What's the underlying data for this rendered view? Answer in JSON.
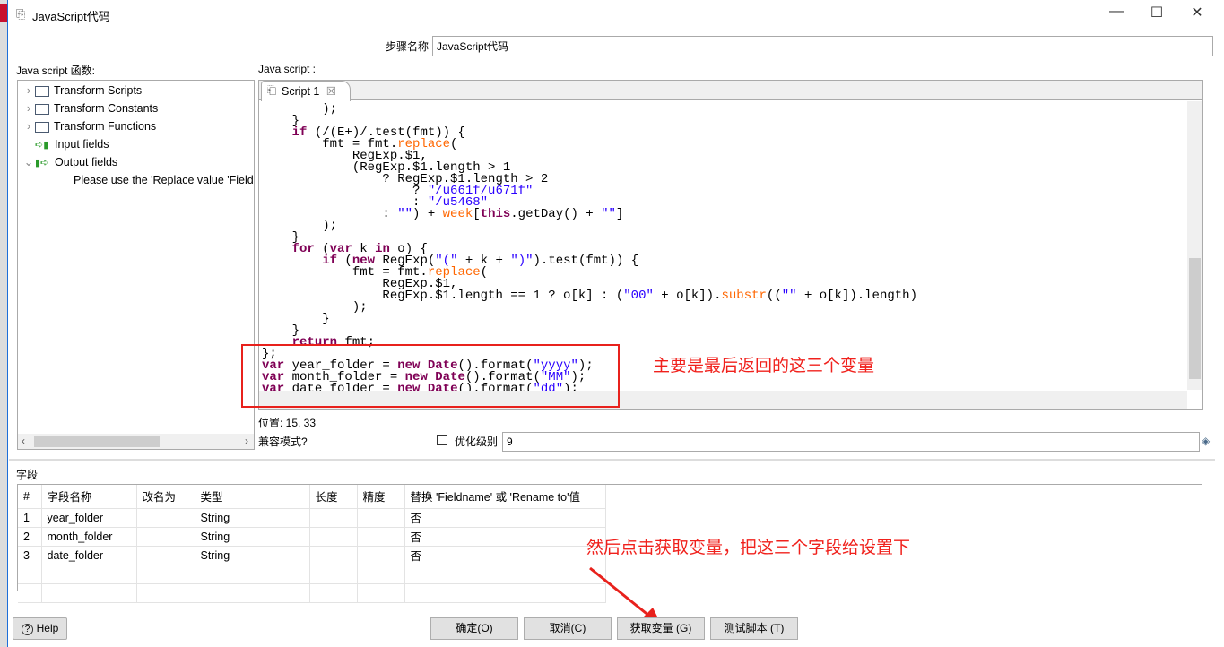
{
  "window": {
    "title": "JavaScript代码",
    "minimize": "—",
    "maximize": "☐",
    "close": "✕"
  },
  "step_name": {
    "label": "步骤名称",
    "value": "JavaScript代码"
  },
  "functions_label": "Java script 函数:",
  "script_label": "Java script :",
  "tree": [
    {
      "label": "Transform Scripts",
      "icon": "folder-icon",
      "expander": "›"
    },
    {
      "label": "Transform Constants",
      "icon": "folder-icon",
      "expander": "›"
    },
    {
      "label": "Transform Functions",
      "icon": "folder-icon",
      "expander": "›"
    },
    {
      "label": "Input fields",
      "icon": "input-fields-icon",
      "expander": ""
    },
    {
      "label": "Output fields",
      "icon": "output-fields-icon",
      "expander": "⌄"
    },
    {
      "label": "Please use the 'Replace value 'Field",
      "icon": "",
      "expander": ""
    }
  ],
  "editor": {
    "tab": "Script 1",
    "tab_close": "☒",
    "lines": [
      [
        [
          "",
          "        );"
        ]
      ],
      [
        [
          "",
          "    }"
        ]
      ],
      [
        [
          "",
          "    "
        ],
        [
          "k",
          "if"
        ],
        [
          "",
          " (/(E+)/.test(fmt)) {"
        ]
      ],
      [
        [
          "",
          "        fmt = fmt."
        ],
        [
          "o",
          "replace"
        ],
        [
          "",
          "("
        ]
      ],
      [
        [
          "",
          "            RegExp.$1,"
        ]
      ],
      [
        [
          "",
          "            (RegExp.$1.length > 1"
        ]
      ],
      [
        [
          "",
          "                ? RegExp.$1.length > 2"
        ]
      ],
      [
        [
          "",
          "                    ? "
        ],
        [
          "s",
          "\"/u661f/u671f\""
        ]
      ],
      [
        [
          "",
          "                    : "
        ],
        [
          "s",
          "\"/u5468\""
        ]
      ],
      [
        [
          "",
          "                : "
        ],
        [
          "s",
          "\"\""
        ],
        [
          "",
          ") + "
        ],
        [
          "o",
          "week"
        ],
        [
          "",
          "["
        ],
        [
          "k",
          "this"
        ],
        [
          "",
          ".getDay() + "
        ],
        [
          "s",
          "\"\""
        ],
        [
          "",
          "]"
        ]
      ],
      [
        [
          "",
          "        );"
        ]
      ],
      [
        [
          "",
          "    }"
        ]
      ],
      [
        [
          "",
          "    "
        ],
        [
          "k",
          "for"
        ],
        [
          "",
          " ("
        ],
        [
          "k",
          "var"
        ],
        [
          "",
          " k "
        ],
        [
          "k",
          "in"
        ],
        [
          "",
          " o) {"
        ]
      ],
      [
        [
          "",
          "        "
        ],
        [
          "k",
          "if"
        ],
        [
          "",
          " ("
        ],
        [
          "k",
          "new"
        ],
        [
          "",
          " RegExp("
        ],
        [
          "s",
          "\"(\""
        ],
        [
          "",
          " + k + "
        ],
        [
          "s",
          "\")\""
        ],
        [
          "",
          ").test(fmt)) {"
        ]
      ],
      [
        [
          "",
          "            fmt = fmt."
        ],
        [
          "o",
          "replace"
        ],
        [
          "",
          "("
        ]
      ],
      [
        [
          "",
          "                RegExp.$1,"
        ]
      ],
      [
        [
          "",
          "                RegExp.$1.length == 1 ? o[k] : ("
        ],
        [
          "s",
          "\"00\""
        ],
        [
          "",
          " + o[k])."
        ],
        [
          "o",
          "substr"
        ],
        [
          "",
          "(("
        ],
        [
          "s",
          "\"\""
        ],
        [
          "",
          " + o[k]).length)"
        ]
      ],
      [
        [
          "",
          "            );"
        ]
      ],
      [
        [
          "",
          "        }"
        ]
      ],
      [
        [
          "",
          "    }"
        ]
      ],
      [
        [
          "",
          "    "
        ],
        [
          "k",
          "return"
        ],
        [
          "",
          " fmt;"
        ]
      ],
      [
        [
          "",
          "};"
        ]
      ],
      [
        [
          "k",
          "var"
        ],
        [
          "",
          " year_folder = "
        ],
        [
          "k",
          "new"
        ],
        [
          "",
          " "
        ],
        [
          "k",
          "Date"
        ],
        [
          "",
          "().format("
        ],
        [
          "s",
          "\"yyyy\""
        ],
        [
          "",
          ");"
        ]
      ],
      [
        [
          "k",
          "var"
        ],
        [
          "",
          " month_folder = "
        ],
        [
          "k",
          "new"
        ],
        [
          "",
          " "
        ],
        [
          "k",
          "Date"
        ],
        [
          "",
          "().format("
        ],
        [
          "s",
          "\"MM\""
        ],
        [
          "",
          ");"
        ]
      ],
      [
        [
          "k",
          "var"
        ],
        [
          "",
          " date_folder = "
        ],
        [
          "k",
          "new"
        ],
        [
          "",
          " "
        ],
        [
          "k",
          "Date"
        ],
        [
          "",
          "().format("
        ],
        [
          "s",
          "\"dd\""
        ],
        [
          "",
          ");"
        ]
      ]
    ]
  },
  "position": "位置: 15, 33",
  "compat_label": "兼容模式?",
  "optimize": {
    "label": "优化级别",
    "value": "9",
    "checked": false
  },
  "fields_label": "字段",
  "table": {
    "headers": [
      "#",
      "字段名称",
      "改名为",
      "类型",
      "长度",
      "精度",
      "替换 'Fieldname' 或 'Rename to'值"
    ],
    "rows": [
      [
        "1",
        "year_folder",
        "",
        "String",
        "",
        "",
        "否"
      ],
      [
        "2",
        "month_folder",
        "",
        "String",
        "",
        "",
        "否"
      ],
      [
        "3",
        "date_folder",
        "",
        "String",
        "",
        "",
        "否"
      ]
    ]
  },
  "annotations": {
    "top": "主要是最后返回的这三个变量",
    "bottom": "然后点击获取变量，把这三个字段给设置下"
  },
  "buttons": {
    "help": "Help",
    "ok": "确定(O)",
    "cancel": "取消(C)",
    "get_vars": "获取变量 (G)",
    "test": "测试脚本 (T)"
  },
  "colors": {
    "annotation": "#e8211c",
    "keyword": "#7f0055",
    "string": "#2a00ff",
    "method": "#ff6600"
  }
}
